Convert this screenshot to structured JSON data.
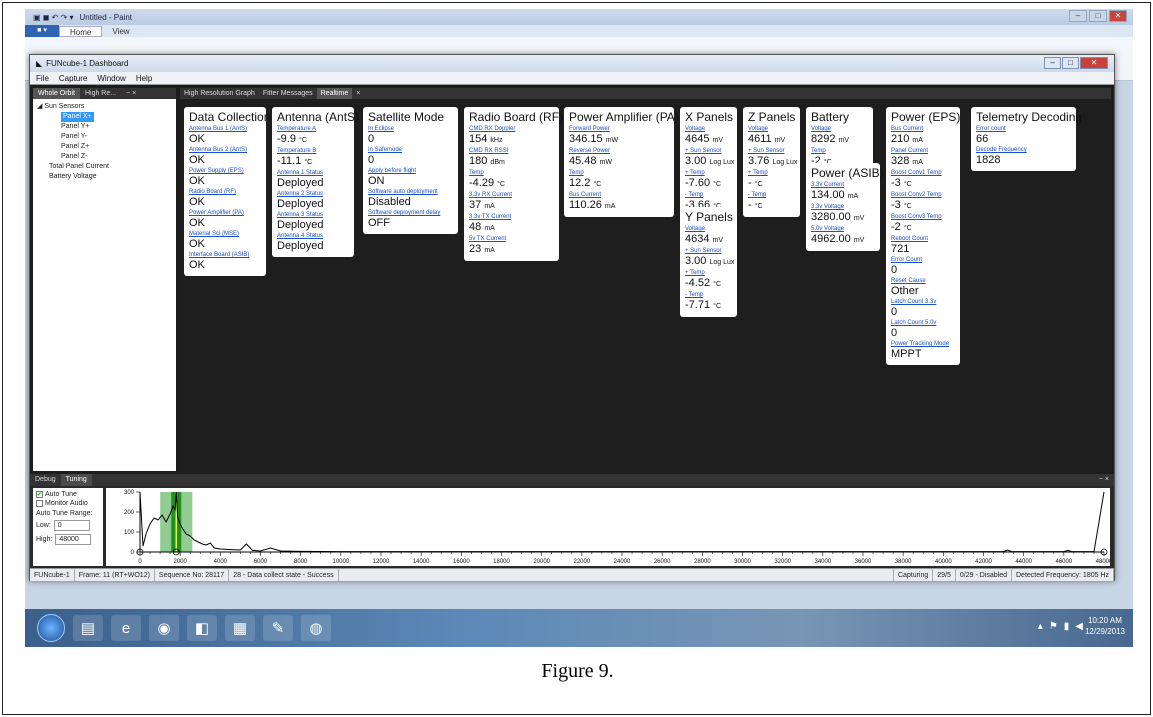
{
  "paint": {
    "title": "Untitled - Paint",
    "tabs": [
      "Home",
      "View"
    ],
    "menu_button": "■ ▾",
    "swatches": [
      "#1a1a1a",
      "#7f7f7f",
      "#880015",
      "#ed1c24",
      "#ff7f27",
      "#fff200",
      "#22b14c",
      "#00a2e8",
      "#3f48cc",
      "#a349a4",
      "#ffffff",
      "#c3c3c3",
      "#b97a57",
      "#ffaec9",
      "#ffc90e",
      "#efe4b0",
      "#b5e61d",
      "#99d9ea",
      "#7092be",
      "#c8bfe7"
    ]
  },
  "funcube": {
    "title": "FUNcube-1 Dashboard",
    "menu": [
      "File",
      "Capture",
      "Window",
      "Help"
    ],
    "left_tabs": [
      "Whole Orbit",
      "High Re...",
      "−  ×"
    ],
    "tree": [
      {
        "label": "◢ Sun Sensors",
        "level": 0,
        "selected": false
      },
      {
        "label": "Panel X+",
        "level": 2,
        "selected": true
      },
      {
        "label": "Panel Y+",
        "level": 2,
        "selected": false
      },
      {
        "label": "Panel Y-",
        "level": 2,
        "selected": false
      },
      {
        "label": "Panel Z+",
        "level": 2,
        "selected": false
      },
      {
        "label": "Panel Z-",
        "level": 2,
        "selected": false
      },
      {
        "label": "Total Panel Current",
        "level": 1,
        "selected": false
      },
      {
        "label": "Battery Voltage",
        "level": 1,
        "selected": false
      }
    ],
    "right_tabs": [
      "High Resolution Graph",
      "Fitter Messages",
      "Realtime",
      "×"
    ],
    "cards": [
      {
        "title": "Data Collection",
        "fields": [
          {
            "label": "Antenna Bus 1 (AntS)",
            "value": "OK"
          },
          {
            "label": "Antenna Bus 2 (AntS)",
            "value": "OK"
          },
          {
            "label": "Power Supply (EPS)",
            "value": "OK"
          },
          {
            "label": "Radio Board (RF)",
            "value": "OK"
          },
          {
            "label": "Power Amplifier (PA)",
            "value": "OK"
          },
          {
            "label": "Material Sci (MSE)",
            "value": "OK"
          },
          {
            "label": "Interface Board (ASIB)",
            "value": "OK"
          }
        ]
      },
      {
        "title": "Antenna (AntS)",
        "fields": [
          {
            "label": "Temperature A",
            "value": "-9.9",
            "unit": "°C"
          },
          {
            "label": "Temperature B",
            "value": "-11.1",
            "unit": "°C"
          },
          {
            "label": "Antenna 1 Status",
            "value": "Deployed"
          },
          {
            "label": "Antenna 2 Status",
            "value": "Deployed"
          },
          {
            "label": "Antenna 3 Status",
            "value": "Deployed"
          },
          {
            "label": "Antenna 4 Status",
            "value": "Deployed"
          }
        ]
      },
      {
        "title": "Satellite Mode",
        "fields": [
          {
            "label": "In Eclipse",
            "value": "0"
          },
          {
            "label": "In Safemode",
            "value": "0"
          },
          {
            "label": "Apply before flight",
            "value": "ON"
          },
          {
            "label": "Software auto deployment",
            "value": "Disabled"
          },
          {
            "label": "Software deployment delay",
            "value": "OFF"
          }
        ]
      },
      {
        "title": "Radio Board (RF)",
        "fields": [
          {
            "label": "CMD RX Doppler",
            "value": "154",
            "unit": "kHz"
          },
          {
            "label": "CMD RX RSSI",
            "value": "180",
            "unit": "dBm"
          },
          {
            "label": "Temp",
            "value": "-4.29",
            "unit": "°C"
          },
          {
            "label": "3.3v RX Current",
            "value": "37",
            "unit": "mA"
          },
          {
            "label": "3.3v TX Current",
            "value": "48",
            "unit": "mA"
          },
          {
            "label": "5v TX Current",
            "value": "23",
            "unit": "mA"
          }
        ]
      },
      {
        "title": "Power Amplifier (PA)",
        "fields": [
          {
            "label": "Forward Power",
            "value": "346.15",
            "unit": "mW"
          },
          {
            "label": "Reverse Power",
            "value": "45.48",
            "unit": "mW"
          },
          {
            "label": "Temp",
            "value": "12.2",
            "unit": "°C"
          },
          {
            "label": "Bus Current",
            "value": "110.26",
            "unit": "mA"
          }
        ]
      },
      {
        "title": "X Panels",
        "fields": [
          {
            "label": "Voltage",
            "value": "4645",
            "unit": "mV"
          },
          {
            "label": "+ Sun Sensor",
            "value": "3.00",
            "unit": "Log Lux"
          },
          {
            "label": "+ Temp",
            "value": "-7.60",
            "unit": "°C"
          },
          {
            "label": "- Temp",
            "value": "-3.66",
            "unit": "°C"
          }
        ]
      },
      {
        "title": "Z Panels",
        "fields": [
          {
            "label": "Voltage",
            "value": "4611",
            "unit": "mV"
          },
          {
            "label": "+ Sun Sensor",
            "value": "3.76",
            "unit": "Log Lux"
          },
          {
            "label": "+ Temp",
            "value": "-",
            "unit": "°C"
          },
          {
            "label": "- Temp",
            "value": "-",
            "unit": "°C"
          }
        ]
      },
      {
        "title": "Battery",
        "fields": [
          {
            "label": "Voltage",
            "value": "8292",
            "unit": "mV"
          },
          {
            "label": "Temp",
            "value": "-2",
            "unit": "°C"
          }
        ]
      },
      {
        "title": "Y Panels",
        "fields": [
          {
            "label": "Voltage",
            "value": "4634",
            "unit": "mV"
          },
          {
            "label": "+ Sun Sensor",
            "value": "3.00",
            "unit": "Log Lux"
          },
          {
            "label": "+ Temp",
            "value": "-4.52",
            "unit": "°C"
          },
          {
            "label": "- Temp",
            "value": "-7.71",
            "unit": "°C"
          }
        ]
      },
      {
        "title": "Power (ASIB)",
        "fields": [
          {
            "label": "3.3v Current",
            "value": "134.00",
            "unit": "mA"
          },
          {
            "label": "3.3v Voltage",
            "value": "3280.00",
            "unit": "mV"
          },
          {
            "label": "5.0v Voltage",
            "value": "4962.00",
            "unit": "mV"
          }
        ]
      },
      {
        "title": "Power (EPS)",
        "fields": [
          {
            "label": "Bus Current",
            "value": "210",
            "unit": "mA"
          },
          {
            "label": "Panel Current",
            "value": "328",
            "unit": "mA"
          },
          {
            "label": "Boost Conv1 Temp",
            "value": "-3",
            "unit": "°C"
          },
          {
            "label": "Boost Conv2 Temp",
            "value": "-3",
            "unit": "°C"
          },
          {
            "label": "Boost Conv3 Temp",
            "value": "-2",
            "unit": "°C"
          },
          {
            "label": "Reboot Count",
            "value": "721"
          },
          {
            "label": "Error Count",
            "value": "0"
          },
          {
            "label": "Reset Cause",
            "value": "Other"
          },
          {
            "label": "Latch Count 3.3v",
            "value": "0"
          },
          {
            "label": "Latch Count 5.0v",
            "value": "0"
          },
          {
            "label": "Power Tracking Mode",
            "value": "MPPT"
          }
        ]
      },
      {
        "title": "Telemetry Decoding",
        "fields": [
          {
            "label": "Error count",
            "value": "66"
          },
          {
            "label": "Decode Frequency",
            "value": "1828"
          }
        ]
      }
    ],
    "debug_tabs": [
      "Debug",
      "Tuning",
      "−  ×"
    ],
    "tuning": {
      "auto_tune": "Auto Tune",
      "auto_tune_checked": true,
      "monitor_audio": "Monitor Audio",
      "monitor_checked": false,
      "range_label": "Auto Tune Range:",
      "low_label": "Low:",
      "low_value": "0",
      "high_label": "High:",
      "high_value": "48000"
    },
    "status": [
      "FUNcube-1",
      "Frame: 11 (RT+WO12)",
      "Sequence No: 28117",
      "28 - Data collect state - Success",
      "Capturing",
      "29/5",
      "0/29 - Disabled",
      "Detected Frequency: 1805 Hz"
    ]
  },
  "taskbar": {
    "icons": [
      "folder-icon",
      "ie-icon",
      "media-icon",
      "app-icon",
      "cube-icon",
      "paint-icon",
      "dish-icon"
    ],
    "time": "10:20 AM",
    "date": "12/29/2013"
  },
  "caption": "Figure 9.",
  "chart_data": {
    "type": "line",
    "title": "",
    "xlabel": "",
    "ylabel": "",
    "xlim": [
      0,
      48000
    ],
    "ylim": [
      0,
      300
    ],
    "xticks": [
      0,
      2000,
      4000,
      6000,
      8000,
      10000,
      12000,
      14000,
      16000,
      18000,
      20000,
      22000,
      24000,
      26000,
      28000,
      30000,
      32000,
      34000,
      36000,
      38000,
      40000,
      42000,
      44000,
      46000,
      48000
    ],
    "yticks": [
      0,
      100,
      200,
      300
    ],
    "highlight_center": 1805,
    "series": [
      {
        "x": [
          0,
          150,
          300,
          500,
          700,
          900,
          1100,
          1300,
          1500,
          1650,
          1750,
          1805,
          1870,
          1950,
          2100,
          2300,
          2500,
          2700,
          2900,
          3100,
          3300,
          3500,
          3700,
          4000,
          4500,
          5000,
          5300,
          5600,
          6000,
          6500,
          7000,
          8000,
          10000,
          12000,
          16000,
          20000,
          24000,
          28000,
          32000,
          36000,
          40000,
          43000,
          43200,
          43400,
          45000,
          46000,
          46200,
          46400,
          47500,
          48000
        ],
        "y": [
          300,
          30,
          90,
          140,
          170,
          160,
          185,
          150,
          190,
          230,
          210,
          310,
          180,
          150,
          120,
          90,
          80,
          60,
          50,
          40,
          35,
          45,
          20,
          15,
          12,
          10,
          40,
          8,
          5,
          20,
          5,
          3,
          2,
          2,
          2,
          2,
          2,
          2,
          2,
          2,
          2,
          2,
          10,
          2,
          2,
          2,
          8,
          2,
          2,
          300
        ]
      }
    ]
  }
}
